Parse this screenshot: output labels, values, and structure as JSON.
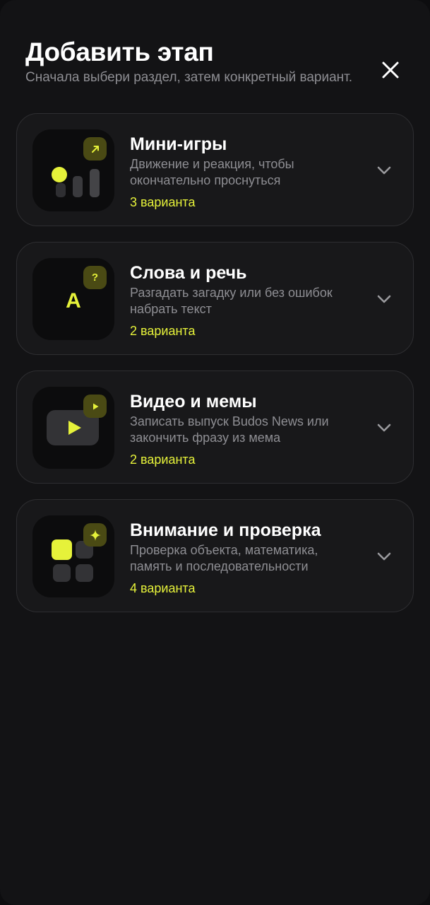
{
  "header": {
    "title": "Добавить этап",
    "subtitle": "Сначала выбери раздел, затем конкретный вариант."
  },
  "colors": {
    "accent": "#e6f23a",
    "background": "#131315",
    "card": "#18181a",
    "muted_text": "#8e8e93"
  },
  "categories": [
    {
      "title": "Мини-игры",
      "description": "Движение и реакция, чтобы окончательно проснуться",
      "count": "3 варианта",
      "icon": "mini-games-icon",
      "badge_icon": "arrow-up-right-icon"
    },
    {
      "title": "Слова и речь",
      "description": "Разгадать загадку или без ошибок набрать текст",
      "count": "2 варианта",
      "icon": "letter-a-icon",
      "badge_icon": "question-mark-icon",
      "icon_letter": "A",
      "badge_text": "?"
    },
    {
      "title": "Видео и мемы",
      "description": "Записать выпуск Budos News или закончить фразу из мема",
      "count": "2 варианта",
      "icon": "video-play-icon",
      "badge_icon": "play-icon"
    },
    {
      "title": "Внимание и проверка",
      "description": "Проверка объекта, математика, память и последовательности",
      "count": "4 варианта",
      "icon": "grid-squares-icon",
      "badge_icon": "sparkle-icon"
    }
  ]
}
